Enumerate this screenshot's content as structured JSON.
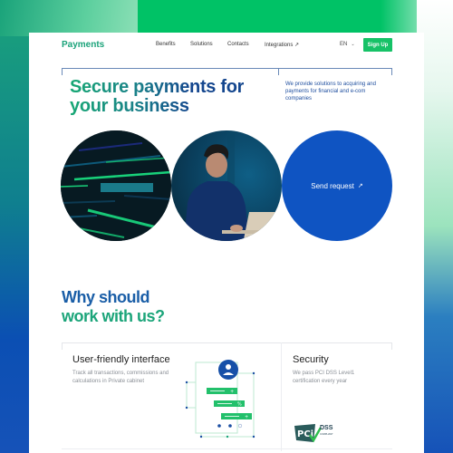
{
  "nav": {
    "logo": "Payments",
    "links": [
      {
        "label": "Benefits"
      },
      {
        "label": "Solutions"
      },
      {
        "label": "Contacts"
      },
      {
        "label": "Integrations ↗"
      }
    ],
    "language": "EN",
    "signup_label": "Sign Up"
  },
  "hero": {
    "title_line1": "Secure payments for",
    "title_line2": "your business",
    "subtitle": "We provide solutions to acquiring and payments for financial and e-com companies",
    "cta_label": "Send request",
    "cta_icon": "arrow-up-right-icon"
  },
  "why": {
    "line1": "Why should",
    "line2": "work with us?"
  },
  "features": [
    {
      "title": "User-friendly interface",
      "description": "Track all transactions, commissions and calculations in Private cabinet"
    },
    {
      "title": "Security",
      "description": "We pass PCI DSS Level1 certification every year",
      "badge_main": "DSS",
      "badge_sub": "COMPLIANT"
    }
  ],
  "colors": {
    "brand_green": "#16c267",
    "brand_blue": "#0f54c2",
    "title_blue": "#1a5ea7",
    "title_green": "#1ca57a"
  }
}
